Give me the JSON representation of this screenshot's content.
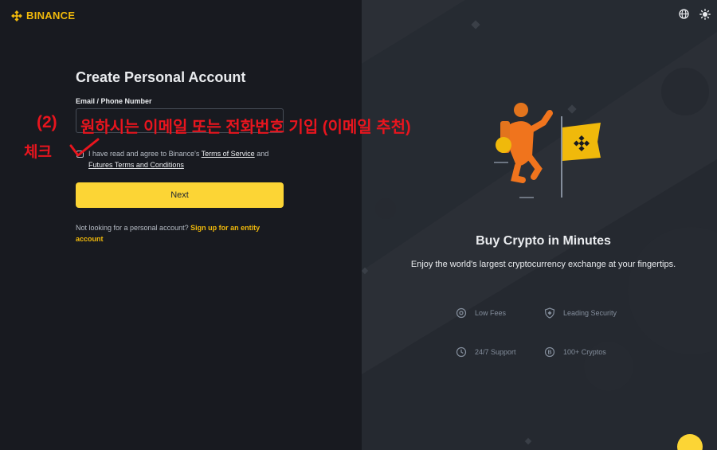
{
  "brand": {
    "name": "BINANCE",
    "color": "#f0b90b"
  },
  "header": {
    "icons": [
      "globe-icon",
      "theme-toggle-icon"
    ]
  },
  "form": {
    "title": "Create Personal Account",
    "email_label": "Email / Phone Number",
    "email_value": "",
    "agree_prefix": "I have read and agree to Binance's ",
    "terms_link": "Terms of Service",
    "agree_and": " and",
    "futures_link": "Futures Terms and Conditions",
    "next_label": "Next",
    "entity_prefix": "Not looking for a personal account? ",
    "entity_link": "Sign up for an entity account"
  },
  "annotation": {
    "number": "(2)",
    "text": "원하시는 이메일 또는 전화번호 기입 (이메일 추천)",
    "check": "체크",
    "color": "#e8151e"
  },
  "promo": {
    "title": "Buy Crypto in Minutes",
    "subtitle": "Enjoy the world's largest cryptocurrency exchange at your fingertips.",
    "features": [
      {
        "icon": "low-fees-icon",
        "label": "Low Fees"
      },
      {
        "icon": "shield-icon",
        "label": "Leading Security"
      },
      {
        "icon": "clock-icon",
        "label": "24/7 Support"
      },
      {
        "icon": "crypto-coin-icon",
        "label": "100+ Cryptos"
      }
    ]
  },
  "colors": {
    "accent": "#fcd535",
    "bg_left": "#181a20",
    "bg_right": "#2b2f36"
  }
}
